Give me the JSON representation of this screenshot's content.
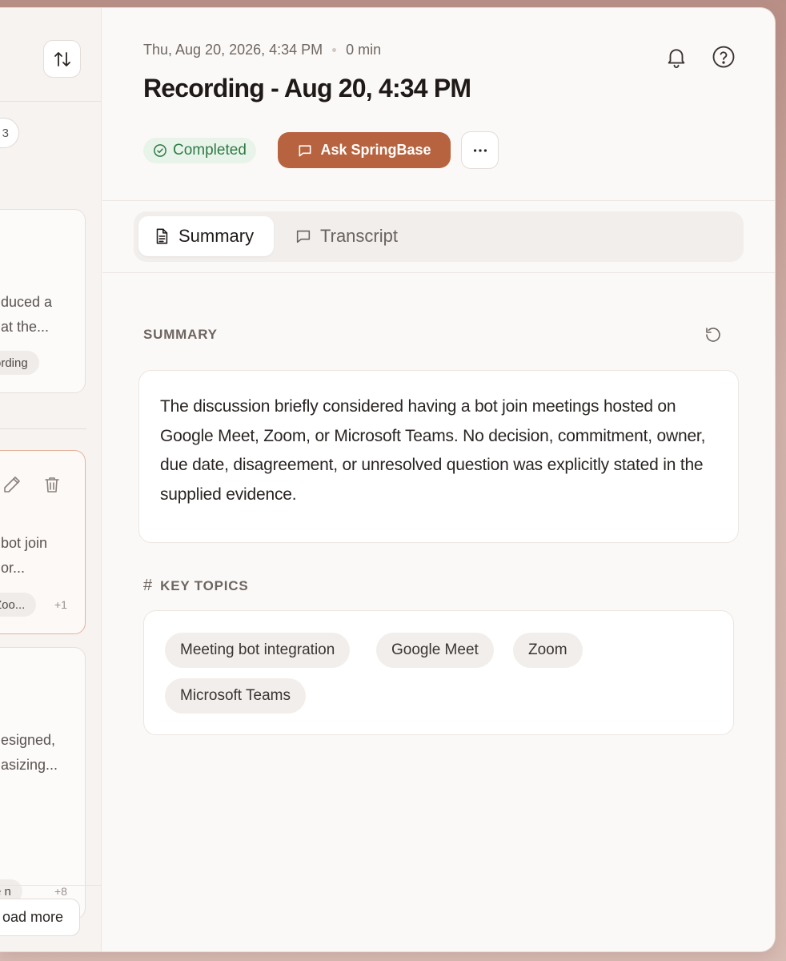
{
  "left_panel": {
    "pill_fragment": "3",
    "card1": {
      "text_lines": [
        "duced a",
        "at the..."
      ],
      "chip": "ording"
    },
    "card2": {
      "text_lines": [
        "bot join",
        "or..."
      ],
      "chip": "Zoo...",
      "more_count": "+1"
    },
    "card3": {
      "text_lines": [
        "esigned,",
        "asizing..."
      ],
      "chip": "e n",
      "more_count": "+8"
    },
    "load_more_label": "oad more"
  },
  "header": {
    "datetime": "Thu, Aug 20, 2026, 4:34 PM",
    "duration": "0 min",
    "title": "Recording - Aug 20, 4:34 PM",
    "status": "Completed",
    "ask_button": "Ask SpringBase"
  },
  "tabs": [
    {
      "label": "Summary",
      "active": true
    },
    {
      "label": "Transcript",
      "active": false
    }
  ],
  "summary": {
    "section_label": "SUMMARY",
    "text": "The discussion briefly considered having a bot join meetings hosted on Google Meet, Zoom, or Microsoft Teams. No decision, commitment, owner, due date, disagreement, or unresolved question was explicitly stated in the supplied evidence."
  },
  "key_topics": {
    "section_label": "KEY TOPICS",
    "items": [
      "Meeting bot integration",
      "Google Meet",
      "Zoom",
      "Microsoft Teams"
    ]
  },
  "colors": {
    "accent": "#b8633f",
    "status_bg": "#e8f4ea",
    "status_fg": "#2f7a45",
    "active_card_border": "#e3b39c"
  }
}
